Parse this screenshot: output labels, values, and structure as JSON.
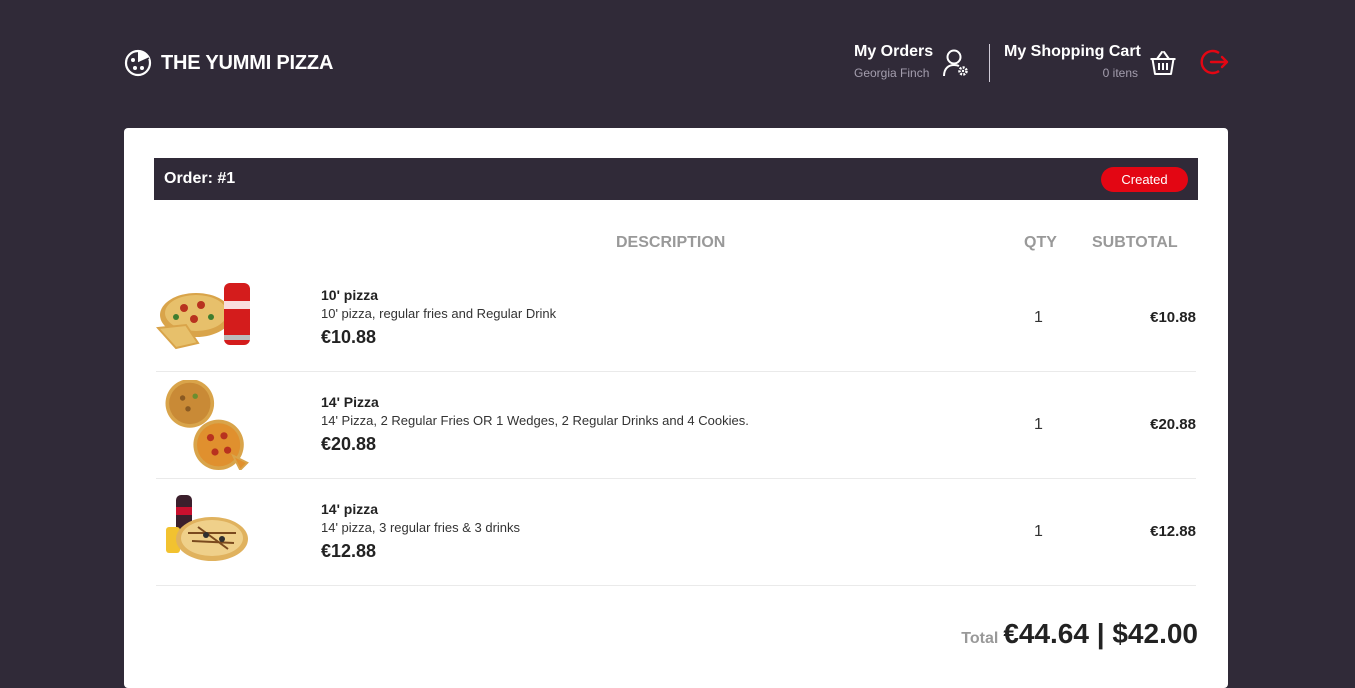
{
  "brand": {
    "name": "THE YUMMI PIZZA"
  },
  "nav": {
    "orders_title": "My Orders",
    "user_name": "Georgia Finch",
    "cart_title": "My Shopping Cart",
    "cart_count": "0 itens"
  },
  "order": {
    "title": "Order: #1",
    "status": "Created",
    "columns": {
      "description": "DESCRIPTION",
      "qty": "QTY",
      "subtotal": "SUBTOTAL"
    },
    "items": [
      {
        "name": "10' pizza",
        "description": "10' pizza, regular fries and Regular Drink",
        "price": "€10.88",
        "qty": "1",
        "subtotal": "€10.88"
      },
      {
        "name": "14' Pizza",
        "description": "14' Pizza, 2 Regular Fries OR 1 Wedges, 2 Regular Drinks and 4 Cookies.",
        "price": "€20.88",
        "qty": "1",
        "subtotal": "€20.88"
      },
      {
        "name": "14' pizza",
        "description": "14' pizza, 3 regular fries & 3 drinks",
        "price": "€12.88",
        "qty": "1",
        "subtotal": "€12.88"
      }
    ],
    "total_label": "Total",
    "total_value": "€44.64 | $42.00"
  },
  "colors": {
    "background": "#302a38",
    "accent": "#e30613"
  }
}
